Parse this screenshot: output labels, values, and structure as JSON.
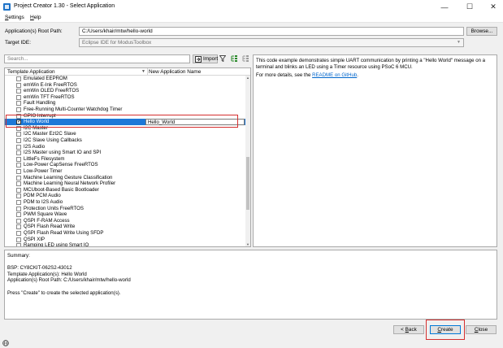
{
  "window": {
    "title": "Project Creator 1.30 - Select Application",
    "minimize_glyph": "—",
    "maximize_glyph": "☐",
    "close_glyph": "✕"
  },
  "menu": {
    "settings_u": "S",
    "settings_rest": "ettings",
    "help_u": "H",
    "help_rest": "elp"
  },
  "root_path": {
    "label": "Application(s) Root Path:",
    "value": "C:/Users/khair/mtw/hello-world",
    "browse_label": "Browse..."
  },
  "target_ide": {
    "label": "Target IDE:",
    "value": "Eclipse IDE for ModusToolbox"
  },
  "toolbar": {
    "search_placeholder": "Search...",
    "import_label": "Import"
  },
  "table": {
    "col_template": "Template Application",
    "col_newname": "New Application Name",
    "rows": [
      "Emulated EEPROM",
      "emWin E-Ink FreeRTOS",
      "emWin OLED FreeRTOS",
      "emWin TFT FreeRTOS",
      "Fault Handling",
      "Free-Running Multi-Counter Watchdog Timer",
      "GPIO Interrupt",
      "Hello World",
      "I2C Master",
      "I2C Master Ezl2C Slave",
      "I2C Slave Using Callbacks",
      "I2S Audio",
      "I2S Master using Smart IO and SPI",
      "LittleFs Filesystem",
      "Low-Power CapSense FreeRTOS",
      "Low-Power Timer",
      "Machine Learning Gesture Classification",
      "Machine Learning Neural Network Profiler",
      "MCUboot-Based Basic Bootloader",
      "PDM PCM Audio",
      "PDM to I2S Audio",
      "Protection Units FreeRTOS",
      "PWM Square Wave",
      "QSPI F-RAM Access",
      "QSPI Flash Read Write",
      "QSPI Flash Read Write Using SFDP",
      "QSPI XIP",
      "Ramping LED using Smart IO"
    ],
    "selected_index": 7,
    "selected_new_name": "Hello_World"
  },
  "description": {
    "text": "This code example demonstrates simple UART communication by printing a \"Hello World\" message on a terminal and blinks an LED using a Timer resource using PSoC 6 MCU.",
    "more_prefix": "For more details, see the ",
    "link": "README on GitHub",
    "more_suffix": "."
  },
  "summary": {
    "heading": "Summary:",
    "bsp": "BSP: CY8CKIT-062S2-43012",
    "templates": "Template Application(s): Hello World",
    "root": "Application(s) Root Path: C:/Users/khair/mtw/hello-world",
    "instruction": "Press \"Create\" to create the selected application(s)."
  },
  "buttons": {
    "back_prefix": "< ",
    "back_u": "B",
    "back_rest": "ack",
    "create_u": "C",
    "create_rest": "reate",
    "close_u": "C",
    "close_rest": "lose"
  },
  "colors": {
    "selection": "#1e78d7",
    "highlight_box": "#d42f2f",
    "link": "#0066cc"
  }
}
